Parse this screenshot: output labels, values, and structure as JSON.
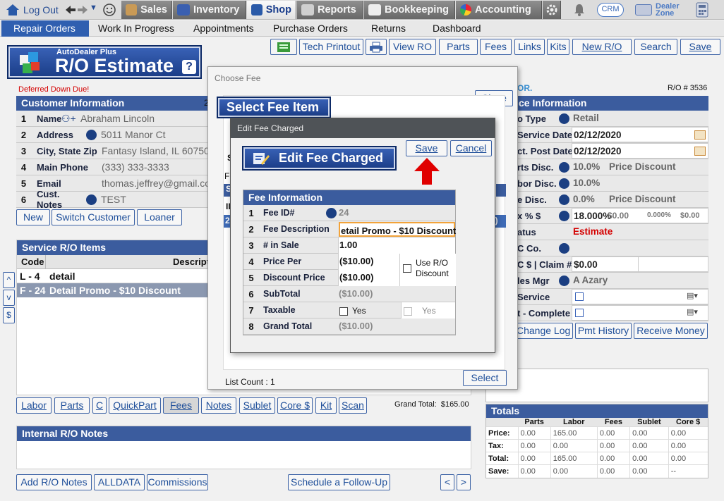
{
  "topnav": {
    "logout": "Log Out",
    "sales": "Sales",
    "inventory": "Inventory",
    "shop": "Shop",
    "reports": "Reports",
    "bookkeeping": "Bookkeeping",
    "accounting": "Accounting",
    "crm": "CRM",
    "dealer1": "Dealer",
    "dealer2": "Zone"
  },
  "subnav": {
    "items": [
      "Repair Orders",
      "Work In Progress",
      "Appointments",
      "Purchase Orders",
      "Returns",
      "Dashboard"
    ]
  },
  "toolbar": {
    "tech": "Tech Printout",
    "view": "View RO",
    "parts": "Parts",
    "fees": "Fees",
    "links": "Links",
    "kits": "Kits",
    "newro": "New R/O",
    "search": "Search",
    "save": "Save"
  },
  "logo": {
    "small": "AutoDealer Plus",
    "big": "R/O Estimate",
    "help": "?"
  },
  "warning": "Deferred Down Due!",
  "customer": {
    "title": "Customer Information",
    "title_peek": "2",
    "rows": [
      {
        "n": "1",
        "label": "Name",
        "value": "Abraham Lincoln"
      },
      {
        "n": "2",
        "label": "Address",
        "value": "5011 Manor Ct"
      },
      {
        "n": "3",
        "label": "City, State Zip",
        "value": "Fantasy Island, IL 60750"
      },
      {
        "n": "4",
        "label": "Main Phone",
        "value": "(333) 333-3333"
      },
      {
        "n": "5",
        "label": "Email",
        "value": "thomas.jeffrey@gmail.co"
      },
      {
        "n": "6",
        "label": "Cust. Notes",
        "value": "TEST"
      }
    ],
    "buttons": {
      "new": "New",
      "switch": "Switch Customer",
      "loaner": "Loaner"
    }
  },
  "service_items": {
    "title": "Service R/O Items",
    "col_code": "Code",
    "col_desc": "Descriptio",
    "rows": [
      {
        "code": "L - 4",
        "desc": "detail"
      },
      {
        "code": "F - 24",
        "desc": "Detail Promo - $10 Discount"
      }
    ]
  },
  "side_arrows": {
    "up": "^",
    "down": "v",
    "dollar": "$"
  },
  "bottom_buttons": {
    "labor": "Labor",
    "parts": "Parts",
    "c": "C",
    "quickpart": "QuickPart",
    "fees": "Fees",
    "notes": "Notes",
    "sublet": "Sublet",
    "core": "Core $",
    "kit": "Kit",
    "scan": "Scan"
  },
  "grand_total": "Grand Total:  $165.00",
  "internal_notes": {
    "title": "Internal R/O Notes"
  },
  "notes_buttons": {
    "add": "Add R/O Notes",
    "alldata": "ALLDATA",
    "commissions": "Commissions",
    "followup": "Schedule a Follow-Up",
    "prev": "<",
    "next": ">"
  },
  "right": {
    "brand": "OR.",
    "ro_number": "R/O # 3536",
    "title": "ce Information",
    "rows": [
      {
        "label": "o Type",
        "value": "Retail",
        "extra": "",
        "extra2": "",
        "extra3": ""
      },
      {
        "label": "Service Date",
        "value": "02/12/2020",
        "extra": "",
        "extra2": "",
        "extra3": ""
      },
      {
        "label": "ct. Post Date",
        "value": "02/12/2020",
        "extra": "",
        "extra2": "",
        "extra3": ""
      },
      {
        "label": "rts Disc.",
        "value": "10.0%",
        "extra": "Price Discount",
        "extra2": "",
        "extra3": ""
      },
      {
        "label": "bor Disc.",
        "value": "10.0%",
        "extra": "",
        "extra2": "",
        "extra3": ""
      },
      {
        "label": "e Disc.",
        "value": "0.0%",
        "extra": "Price Discount",
        "extra2": "",
        "extra3": ""
      },
      {
        "label": "x % $",
        "value": "18.000%",
        "extra": "$0.00",
        "extra2": "0.000%",
        "extra3": "$0.00"
      },
      {
        "label": "atus",
        "value": "Estimate",
        "extra": "",
        "extra2": "",
        "extra3": ""
      },
      {
        "label": "C Co.",
        "value": "",
        "extra": "",
        "extra2": "",
        "extra3": ""
      },
      {
        "label": "C $ | Claim #",
        "value": "$0.00",
        "extra": "",
        "extra2": "",
        "extra3": ""
      },
      {
        "label": "les Mgr",
        "value": "A Azary",
        "extra": "",
        "extra2": "",
        "extra3": ""
      },
      {
        "label": "Service",
        "value": "",
        "extra": "",
        "extra2": "",
        "extra3": ""
      },
      {
        "label": "t - Complete",
        "value": "",
        "extra": "",
        "extra2": "",
        "extra3": ""
      }
    ],
    "buttons": {
      "changelog": "Change Log",
      "pmt": "Pmt History",
      "receive": "Receive Money"
    }
  },
  "totals": {
    "title": "Totals",
    "cols": [
      "",
      "Parts",
      "Labor",
      "Fees",
      "Sublet",
      "Core $"
    ],
    "rows": [
      {
        "label": "Price:",
        "vals": [
          "0.00",
          "165.00",
          "0.00",
          "0.00",
          "0.00"
        ]
      },
      {
        "label": "Tax:",
        "vals": [
          "0.00",
          "0.00",
          "0.00",
          "0.00",
          "0.00"
        ]
      },
      {
        "label": "Total:",
        "vals": [
          "0.00",
          "165.00",
          "0.00",
          "0.00",
          "0.00"
        ]
      },
      {
        "label": "Save:",
        "vals": [
          "0.00",
          "0.00",
          "0.00",
          "0.00",
          "--"
        ]
      }
    ]
  },
  "choose_fee": {
    "title": "Choose Fee",
    "close": "Close",
    "header": "Select Fee Item",
    "peek_s": "S",
    "peek_f": "F",
    "peek_s2": "S",
    "peek_i": "II",
    "peek_2": "2",
    "peek_paren": "0)",
    "list_count": "List Count : 1",
    "select": "Select"
  },
  "edit_fee": {
    "title": "Edit Fee Charged",
    "header": "Edit Fee Charged",
    "save": "Save",
    "cancel": "Cancel",
    "section": "Fee Information",
    "rows": [
      {
        "n": "1",
        "label": "Fee ID#",
        "value": "24"
      },
      {
        "n": "2",
        "label": "Fee Description",
        "value": "etail Promo - $10 Discount"
      },
      {
        "n": "3",
        "label": "# in Sale",
        "value": "1.00"
      },
      {
        "n": "4",
        "label": "Price Per",
        "value": "($10.00)"
      },
      {
        "n": "5",
        "label": "Discount Price",
        "value": "($10.00)"
      },
      {
        "n": "6",
        "label": "SubTotal",
        "value": "($10.00)"
      },
      {
        "n": "7",
        "label": "Taxable",
        "value": ""
      },
      {
        "n": "8",
        "label": "Grand Total",
        "value": "($10.00)"
      }
    ],
    "use_ro_1": "Use R/O",
    "use_ro_2": "Discount",
    "yes1": "Yes",
    "yes2": "Yes"
  },
  "colors": {
    "header_blue": "#3b5c9e",
    "accent_red": "#e00000",
    "nav_active": "#2f5fb0"
  }
}
